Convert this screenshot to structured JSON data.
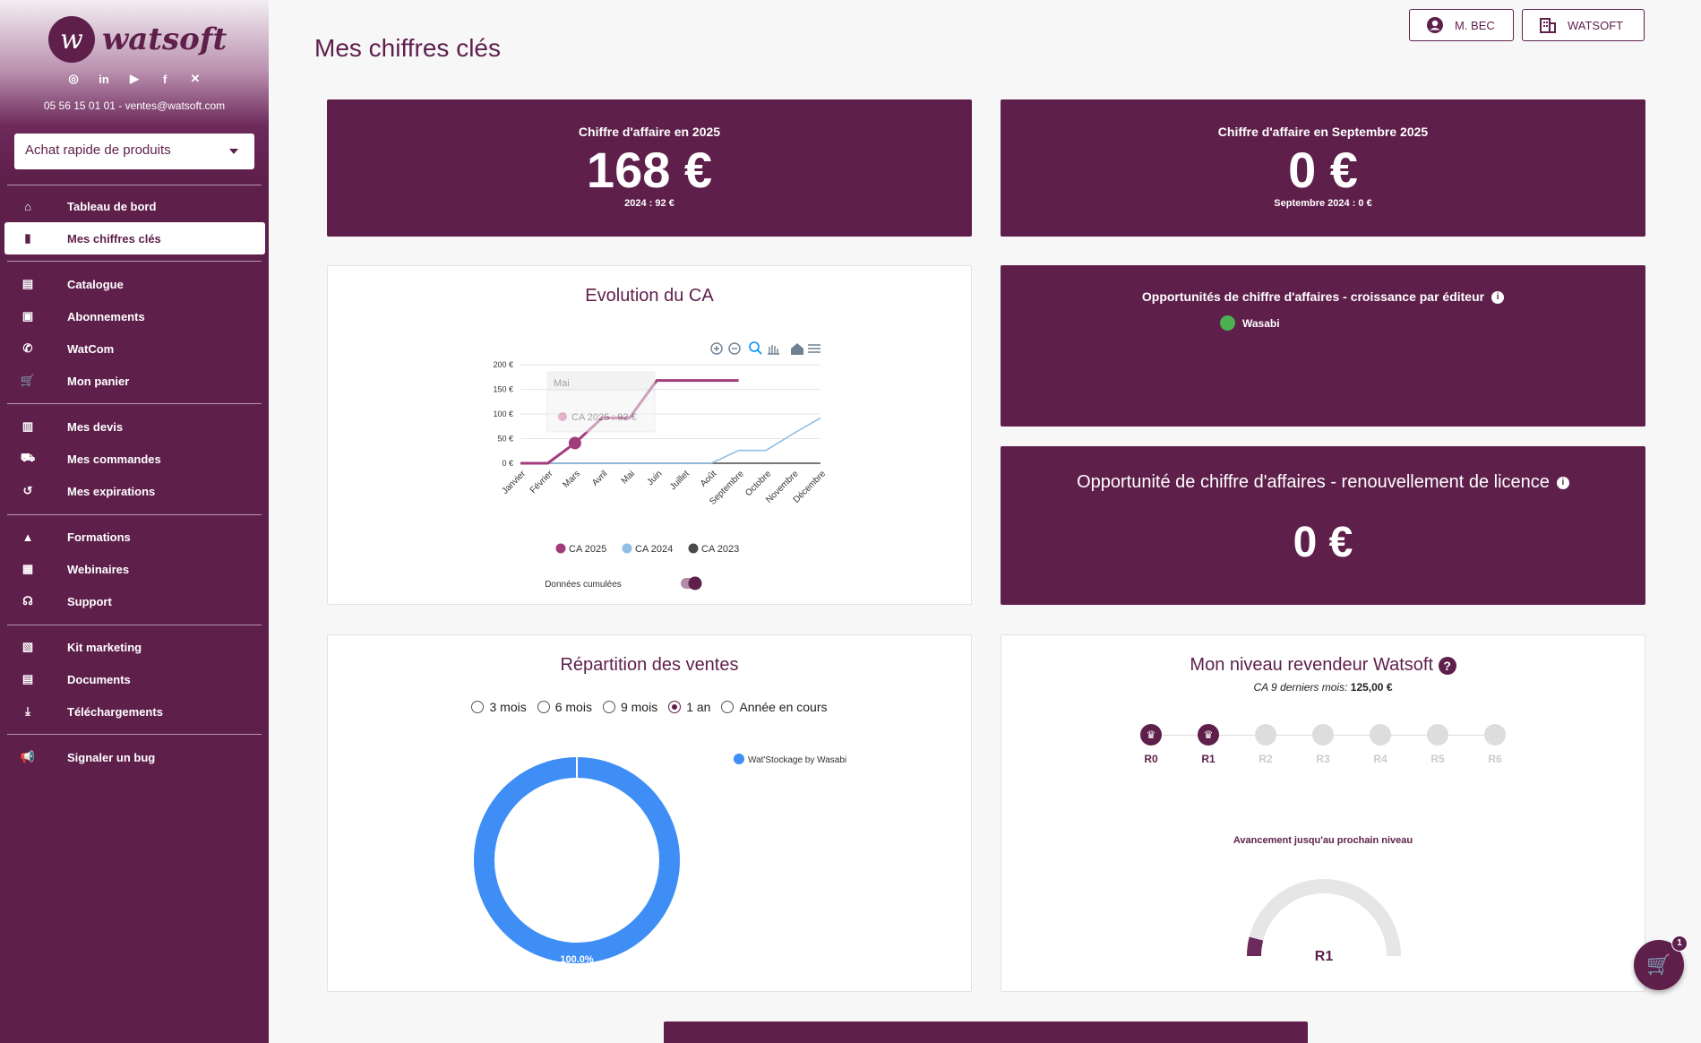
{
  "brand": {
    "name": "watsoft",
    "mark": "w"
  },
  "sidebar": {
    "socials": [
      {
        "icon": "instagram-icon",
        "glyph": "◎"
      },
      {
        "icon": "linkedin-icon",
        "glyph": "in"
      },
      {
        "icon": "youtube-icon",
        "glyph": "▶"
      },
      {
        "icon": "facebook-icon",
        "glyph": "f"
      },
      {
        "icon": "x-icon",
        "glyph": "✕"
      }
    ],
    "contact": "05 56 15 01 01 - ventes@watsoft.com",
    "quick_select": "Achat rapide de produits",
    "items": [
      {
        "label": "Tableau de bord",
        "icon": "home-icon",
        "glyph": "⌂"
      },
      {
        "label": "Mes chiffres clés",
        "icon": "bar-chart-icon",
        "glyph": "▮"
      },
      {
        "label": "Catalogue",
        "icon": "book-icon",
        "glyph": "▤"
      },
      {
        "label": "Abonnements",
        "icon": "inbox-icon",
        "glyph": "▣"
      },
      {
        "label": "WatCom",
        "icon": "phone-icon",
        "glyph": "✆"
      },
      {
        "label": "Mon panier",
        "icon": "cart-icon",
        "glyph": "🛒"
      },
      {
        "label": "Mes devis",
        "icon": "quote-icon",
        "glyph": "▥"
      },
      {
        "label": "Mes commandes",
        "icon": "truck-icon",
        "glyph": "⛟"
      },
      {
        "label": "Mes expirations",
        "icon": "history-icon",
        "glyph": "↺"
      },
      {
        "label": "Formations",
        "icon": "school-icon",
        "glyph": "▲"
      },
      {
        "label": "Webinaires",
        "icon": "webinar-icon",
        "glyph": "▦"
      },
      {
        "label": "Support",
        "icon": "headset-icon",
        "glyph": "☊"
      },
      {
        "label": "Kit marketing",
        "icon": "store-icon",
        "glyph": "▧"
      },
      {
        "label": "Documents",
        "icon": "document-icon",
        "glyph": "▤"
      },
      {
        "label": "Téléchargements",
        "icon": "download-icon",
        "glyph": "⤓"
      },
      {
        "label": "Signaler un bug",
        "icon": "megaphone-icon",
        "glyph": "📢"
      }
    ]
  },
  "header": {
    "title": "Mes chiffres clés",
    "user_button": "M. BEC",
    "company_button": "WATSOFT"
  },
  "kpi": {
    "year": {
      "label": "Chiffre d'affaire en 2025",
      "value": "168 €",
      "sub": "2024 : 92 €"
    },
    "month": {
      "label": "Chiffre d'affaire en Septembre 2025",
      "value": "0 €",
      "sub": "Septembre 2024 : 0 €"
    }
  },
  "opportunities": {
    "growth_title": "Opportunités de chiffre d'affaires - croissance par éditeur",
    "growth_legend": "Wasabi",
    "renewal_title": "Opportunité de chiffre d'affaires - renouvellement de licence",
    "renewal_value": "0 €"
  },
  "evolution": {
    "title": "Evolution du CA",
    "tooltip_month": "Mai",
    "tooltip_text": "CA 2025 : 92 €",
    "cumulative_label": "Données cumulées",
    "chart_data": {
      "type": "line",
      "categories": [
        "Janvier",
        "Février",
        "Mars",
        "Avril",
        "Mai",
        "Juin",
        "Juillet",
        "Août",
        "Septembre",
        "Octobre",
        "Novembre",
        "Décembre"
      ],
      "y_ticks": [
        "0 €",
        "50 €",
        "100 €",
        "150 €",
        "200 €"
      ],
      "ylim": [
        0,
        200
      ],
      "series": [
        {
          "name": "CA 2025",
          "color": "#a23d7d",
          "values": [
            0,
            0,
            41,
            92,
            92,
            168,
            168,
            168,
            168,
            null,
            null,
            null
          ]
        },
        {
          "name": "CA 2024",
          "color": "#8fbde6",
          "values": [
            0,
            0,
            0,
            0,
            0,
            0,
            0,
            0,
            26,
            26,
            60,
            92
          ]
        },
        {
          "name": "CA 2023",
          "color": "#4b4b4b",
          "values": [
            0,
            0,
            0,
            0,
            0,
            0,
            0,
            0,
            0,
            0,
            0,
            0
          ]
        }
      ]
    }
  },
  "repartition": {
    "title": "Répartition des ventes",
    "periods": [
      {
        "label": "3 mois",
        "selected": false
      },
      {
        "label": "6 mois",
        "selected": false
      },
      {
        "label": "9 mois",
        "selected": false
      },
      {
        "label": "1 an",
        "selected": true
      },
      {
        "label": "Année en cours",
        "selected": false
      }
    ],
    "chart_data": {
      "type": "pie",
      "labels": [
        "Wat'Stockage by Wasabi"
      ],
      "values": [
        100.0
      ],
      "colors": [
        "#3f8ef6"
      ],
      "data_labels": [
        "100.0%"
      ]
    }
  },
  "level": {
    "title": "Mon niveau revendeur Watsoft",
    "ca_label": "CA 9 derniers mois:",
    "ca_value": "125,00 €",
    "steps": [
      {
        "label": "R0",
        "achieved": true
      },
      {
        "label": "R1",
        "achieved": true
      },
      {
        "label": "R2",
        "achieved": false
      },
      {
        "label": "R3",
        "achieved": false
      },
      {
        "label": "R4",
        "achieved": false
      },
      {
        "label": "R5",
        "achieved": false
      },
      {
        "label": "R6",
        "achieved": false
      }
    ],
    "progress_label": "Avancement jusqu'au prochain niveau",
    "gauge_label": "R1",
    "gauge_progress": 0.08
  },
  "cart": {
    "count": "1"
  },
  "colors": {
    "brand": "#5e1f4b",
    "accent": "#a23d7d"
  }
}
